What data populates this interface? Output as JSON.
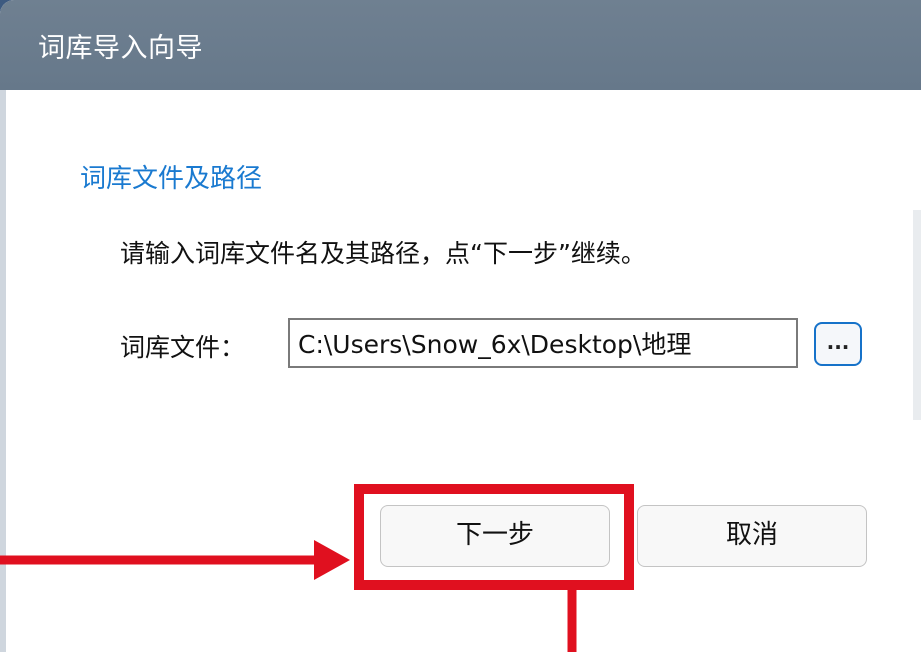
{
  "window": {
    "title": "词库导入向导"
  },
  "section": {
    "title": "词库文件及路径"
  },
  "instruction": "请输入词库文件名及其路径，点“下一步”继续。",
  "file_field": {
    "label": "词库文件：",
    "value": "C:\\Users\\Snow_6x\\Desktop\\地理"
  },
  "browse_button": {
    "label": "..."
  },
  "buttons": {
    "next": "下一步",
    "cancel": "取消"
  },
  "annotation": {
    "color": "#e0101f"
  }
}
